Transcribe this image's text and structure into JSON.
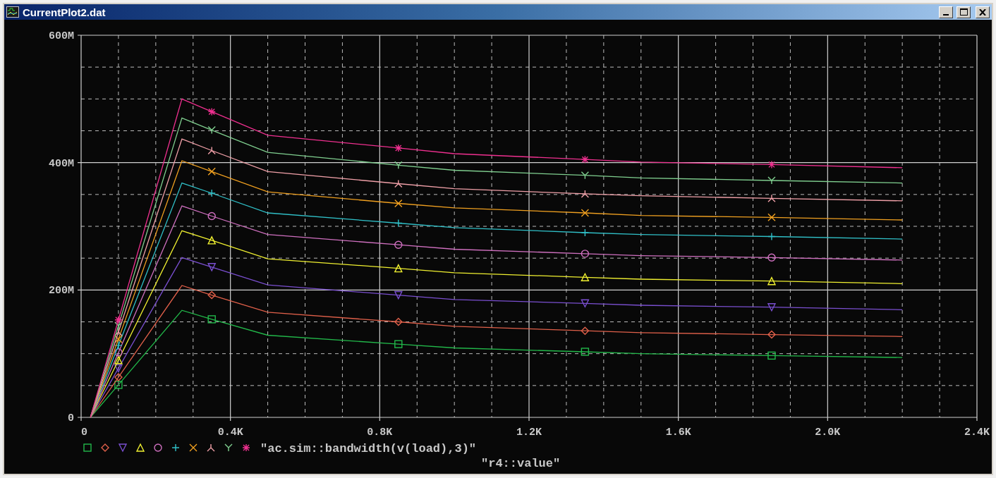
{
  "window": {
    "title": "CurrentPlot2.dat"
  },
  "plot": {
    "legend": {
      "expression": "\"ac.sim::bandwidth(v(load),3)\"",
      "parameter": "\"r4::value\"",
      "items": [
        {
          "kind": "square"
        },
        {
          "kind": "diamond"
        },
        {
          "kind": "triangle-down"
        },
        {
          "kind": "triangle-up"
        },
        {
          "kind": "circle"
        },
        {
          "kind": "plus"
        },
        {
          "kind": "x"
        },
        {
          "kind": "lambda"
        },
        {
          "kind": "y"
        },
        {
          "kind": "asterisk"
        }
      ]
    },
    "chart_data": {
      "type": "line",
      "grid": true,
      "x": [
        25,
        100,
        270,
        350,
        500,
        850,
        1000,
        1350,
        1500,
        1850,
        2200
      ],
      "xlim": [
        0,
        2400
      ],
      "ylim": [
        0,
        600
      ],
      "xticks": [
        {
          "value": 0,
          "label": "0"
        },
        {
          "value": 400,
          "label": "0.4K"
        },
        {
          "value": 800,
          "label": "0.8K"
        },
        {
          "value": 1200,
          "label": "1.2K"
        },
        {
          "value": 1600,
          "label": "1.6K"
        },
        {
          "value": 2000,
          "label": "2.0K"
        },
        {
          "value": 2400,
          "label": "2.4K"
        }
      ],
      "yticks": [
        {
          "value": 0,
          "label": "0"
        },
        {
          "value": 200,
          "label": "200M"
        },
        {
          "value": 400,
          "label": "400M"
        },
        {
          "value": 600,
          "label": "600M"
        }
      ],
      "series": [
        {
          "color": "#22b84a",
          "values": [
            0,
            51,
            168,
            154,
            129,
            115,
            109,
            103,
            100,
            97,
            94
          ]
        },
        {
          "color": "#e0604a",
          "values": [
            0,
            63,
            207,
            192,
            165,
            150,
            143,
            136,
            133,
            130,
            127
          ]
        },
        {
          "color": "#7a4fd0",
          "values": [
            0,
            77,
            251,
            236,
            208,
            192,
            185,
            179,
            176,
            173,
            169
          ]
        },
        {
          "color": "#f0f030",
          "values": [
            0,
            90,
            293,
            278,
            249,
            234,
            227,
            220,
            217,
            214,
            210
          ]
        },
        {
          "color": "#d070c0",
          "values": [
            0,
            102,
            332,
            316,
            287,
            271,
            264,
            257,
            254,
            251,
            247
          ]
        },
        {
          "color": "#30c0c8",
          "values": [
            0,
            113,
            368,
            352,
            321,
            305,
            298,
            290,
            287,
            284,
            280
          ]
        },
        {
          "color": "#f0a020",
          "values": [
            0,
            123,
            403,
            386,
            354,
            336,
            329,
            321,
            317,
            314,
            310
          ]
        },
        {
          "color": "#f0a0a8",
          "values": [
            0,
            134,
            437,
            419,
            386,
            367,
            359,
            351,
            348,
            344,
            340
          ]
        },
        {
          "color": "#80d090",
          "values": [
            0,
            144,
            470,
            451,
            416,
            396,
            388,
            380,
            376,
            372,
            368
          ]
        },
        {
          "color": "#f03090",
          "values": [
            0,
            153,
            500,
            480,
            443,
            423,
            414,
            405,
            401,
            397,
            392
          ]
        }
      ]
    }
  }
}
